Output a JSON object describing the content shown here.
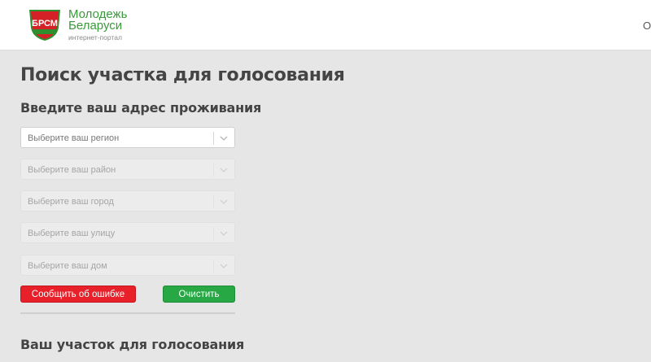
{
  "header": {
    "logo_badge_text": "БРСМ",
    "logo_line1": "Молодежь",
    "logo_line2": "Беларуси",
    "logo_sub": "интернет-портал",
    "right_fragment": "О"
  },
  "page": {
    "title": "Поиск участка для голосования",
    "address_heading": "Введите ваш адрес проживания",
    "result_heading": "Ваш участок для голосования"
  },
  "selects": [
    {
      "placeholder": "Выберите ваш регион",
      "enabled": true
    },
    {
      "placeholder": "Выберите ваш район",
      "enabled": false
    },
    {
      "placeholder": "Выберите ваш город",
      "enabled": false
    },
    {
      "placeholder": "Выберите ваш улицу",
      "enabled": false
    },
    {
      "placeholder": "Выберите ваш дом",
      "enabled": false
    }
  ],
  "buttons": {
    "report_error": "Сообщить об ошибке",
    "clear": "Очистить"
  },
  "colors": {
    "brand_green": "#3a9a3a",
    "badge_red": "#d42027",
    "report_button": "#e8202a",
    "clear_button": "#28a745"
  },
  "icons": {
    "logo": "brsm-badge-icon",
    "dropdown": "chevron-down-icon"
  }
}
